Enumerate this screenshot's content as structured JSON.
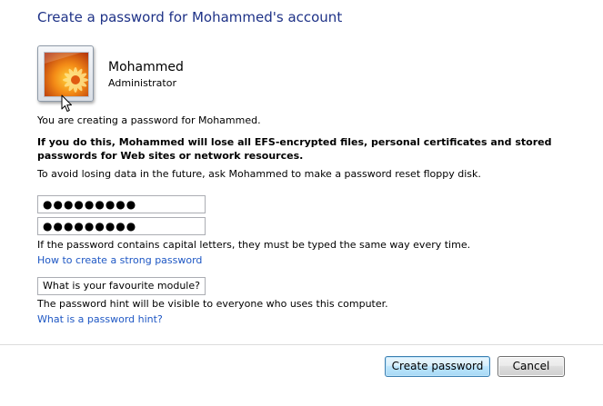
{
  "page": {
    "title": "Create a password for Mohammed's account"
  },
  "user": {
    "name": "Mohammed",
    "role": "Administrator",
    "picture_icon": "orange-flower-picture"
  },
  "info": {
    "creating_text": "You are creating a password for Mohammed.",
    "warning_text": "If you do this, Mohammed will lose all EFS-encrypted files, personal certificates and stored passwords for Web sites or network resources.",
    "advice_text": "To avoid losing data in the future, ask Mohammed to make a password reset floppy disk."
  },
  "form": {
    "new_password_value": "●●●●●●●●●",
    "confirm_password_value": "●●●●●●●●●",
    "capital_letters_note": "If the password contains capital letters, they must be typed the same way every time.",
    "strong_password_link": "How to create a strong password",
    "hint_value": "What is your favourite module?",
    "hint_note": "The password hint will be visible to everyone who uses this computer.",
    "hint_help_link": "What is a password hint?"
  },
  "buttons": {
    "create_label": "Create password",
    "cancel_label": "Cancel"
  },
  "colors": {
    "title": "#1e3287",
    "link": "#1e57c4",
    "primary_button_border": "#3c7fb1"
  }
}
